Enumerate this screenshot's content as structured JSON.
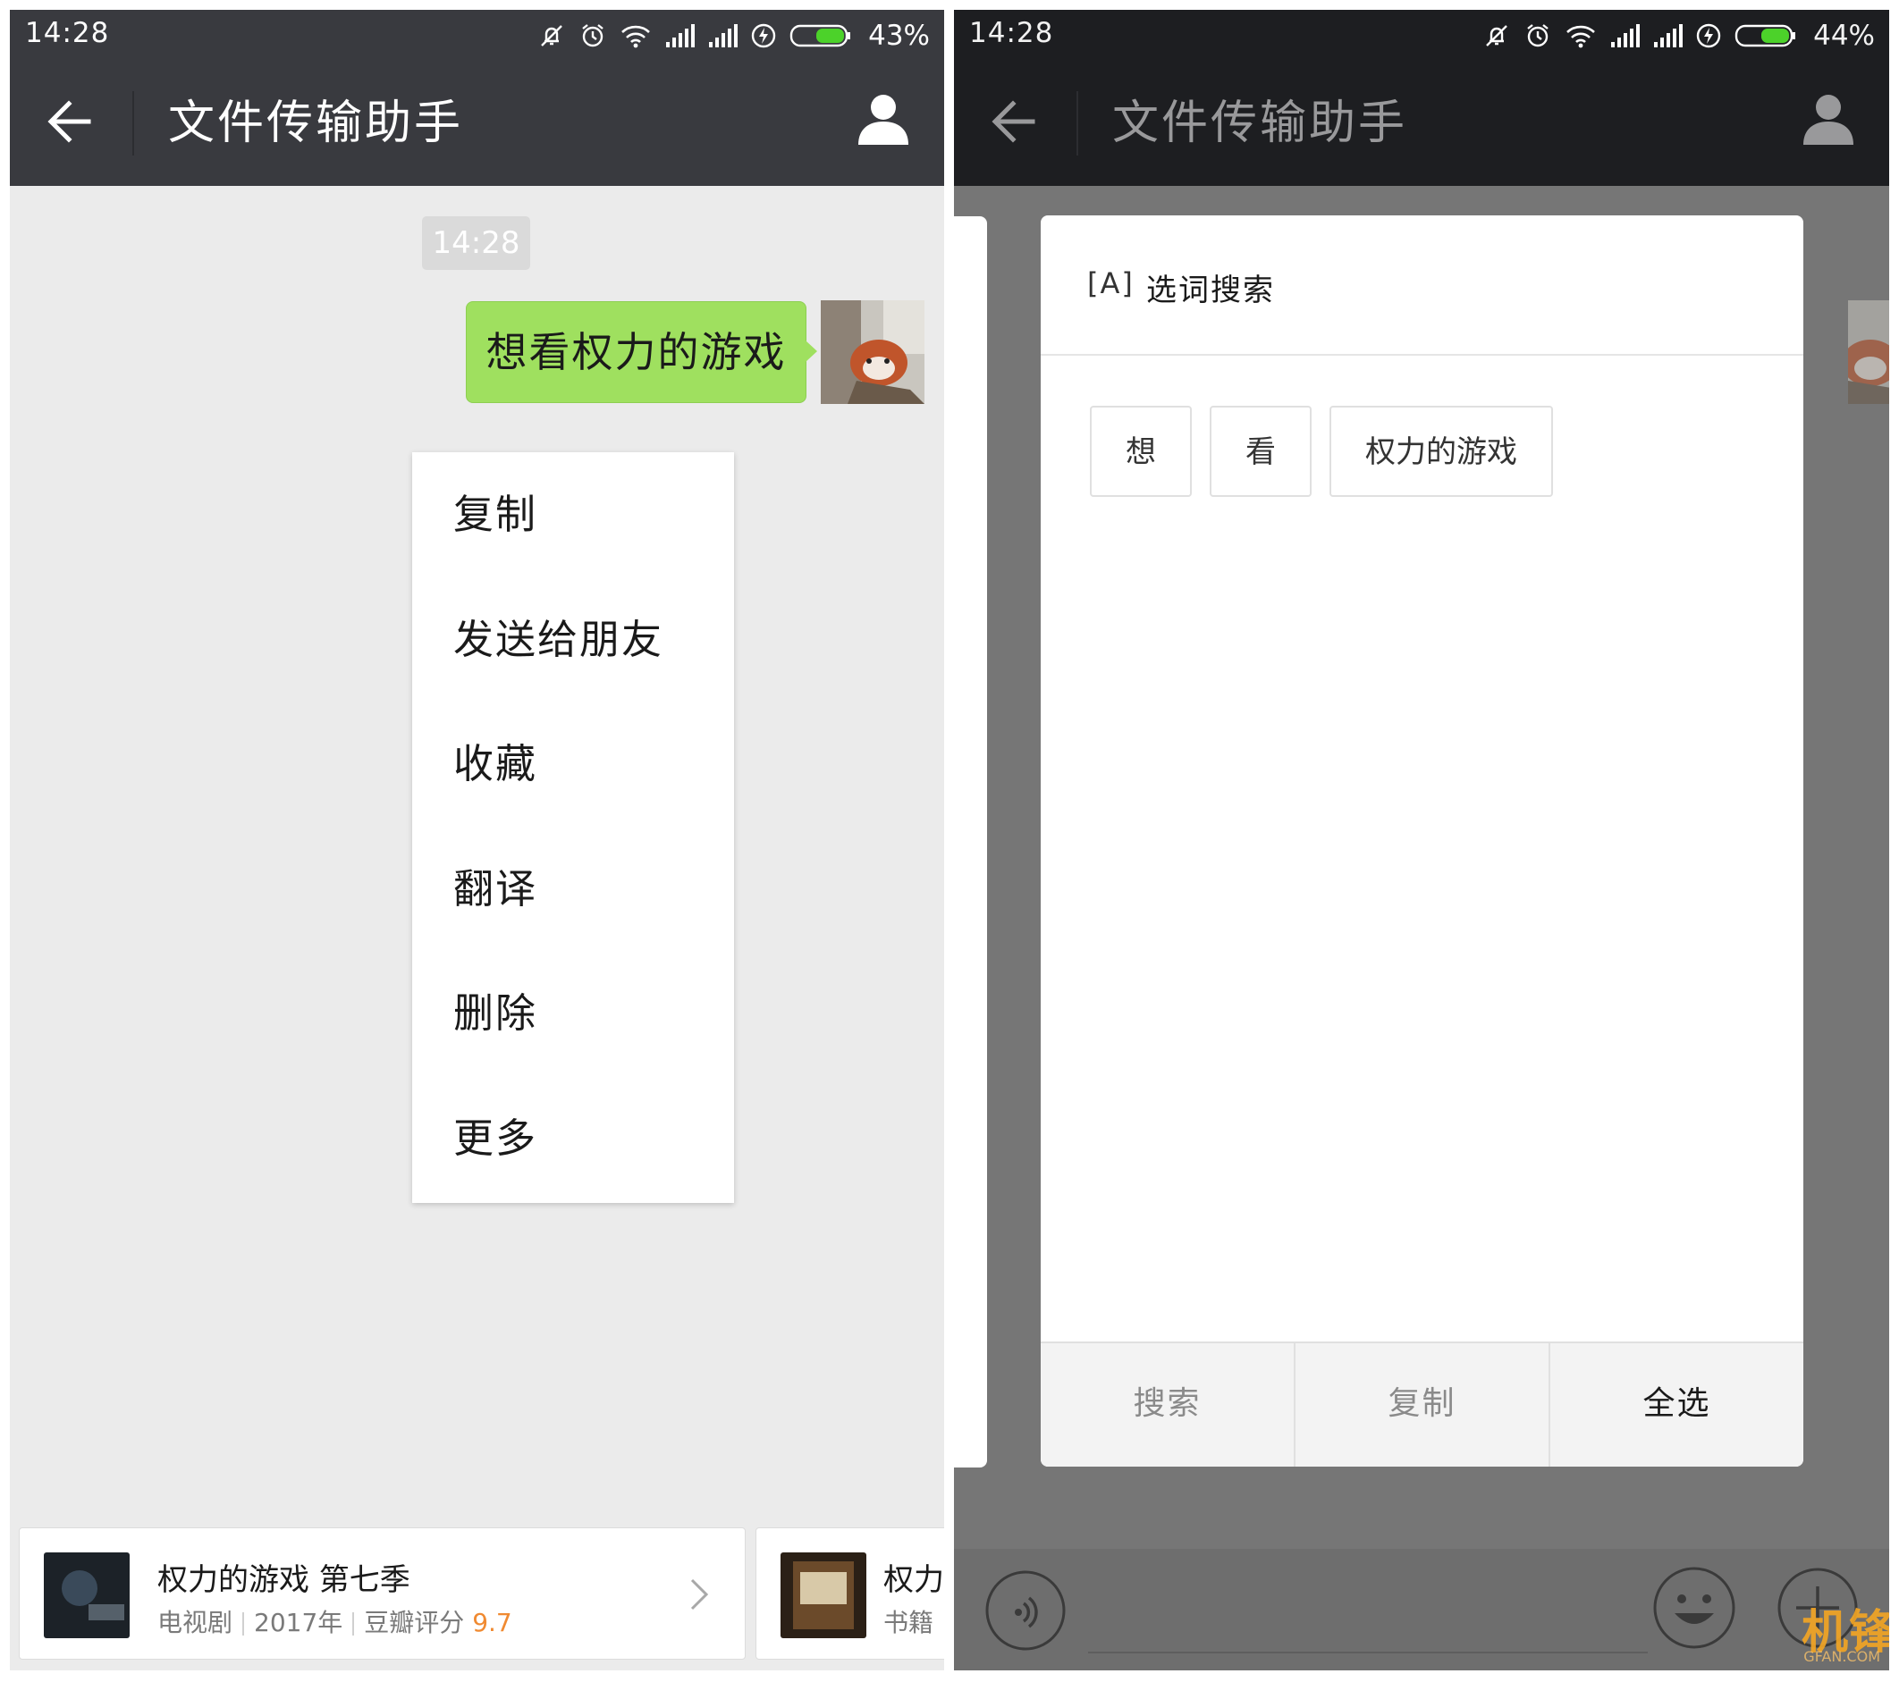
{
  "left": {
    "status": {
      "time": "14:28",
      "battery": "43%"
    },
    "titlebar": {
      "title": "文件传输助手"
    },
    "chat": {
      "timestamp": "14:28",
      "message": "想看权力的游戏"
    },
    "menu": {
      "items": [
        "复制",
        "发送给朋友",
        "收藏",
        "翻译",
        "删除",
        "更多"
      ]
    },
    "cards": [
      {
        "title": "权力的游戏 第七季",
        "type": "电视剧",
        "year": "2017年",
        "rating_label": "豆瓣评分",
        "rating": "9.7"
      },
      {
        "title": "权力",
        "type": "书籍"
      }
    ]
  },
  "right": {
    "status": {
      "time": "14:28",
      "battery": "44%"
    },
    "titlebar": {
      "title": "文件传输助手"
    },
    "dialog": {
      "icon_text": "[A]",
      "title": "选词搜索",
      "words": [
        "想",
        "看",
        "权力的游戏"
      ],
      "buttons": [
        "搜索",
        "复制",
        "全选"
      ]
    },
    "watermark": {
      "brand": "机锋",
      "sub": "GFAN.COM"
    }
  },
  "colors": {
    "titlebar": "#393a3f",
    "bubble": "#9fe05f",
    "chat_bg": "#ebebeb",
    "overlay_bg": "#767676",
    "rating": "#f08a31"
  },
  "icons": [
    "back-arrow-icon",
    "person-icon",
    "silent-icon",
    "alarm-icon",
    "wifi-icon",
    "signal-icon",
    "charging-icon",
    "battery-icon",
    "chevron-right-icon",
    "voice-icon",
    "emoji-icon",
    "plus-icon"
  ]
}
